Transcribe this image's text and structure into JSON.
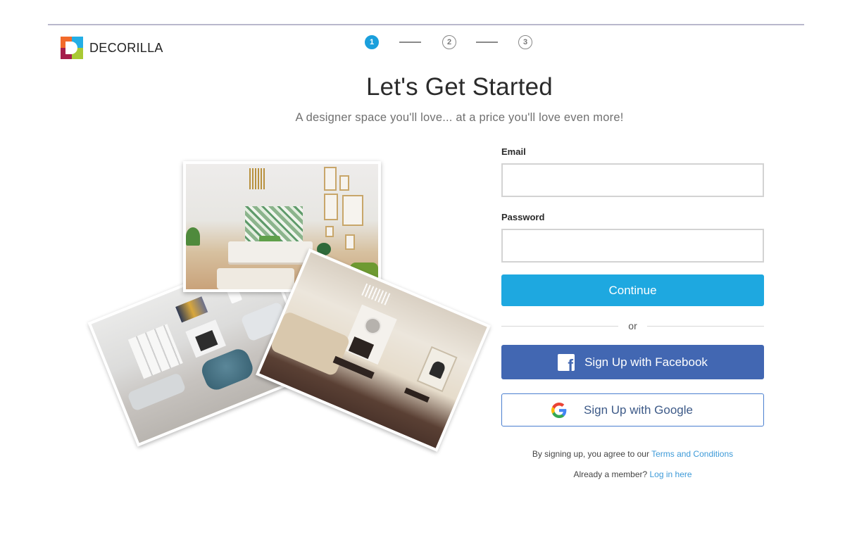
{
  "brand": {
    "name": "DECORILLA",
    "logo_colors": [
      "#f26a2a",
      "#23aee5",
      "#a51d4b",
      "#a9c934"
    ]
  },
  "stepper": {
    "steps": [
      {
        "label": "1",
        "state": "active"
      },
      {
        "label": "2",
        "state": "inactive"
      },
      {
        "label": "3",
        "state": "inactive"
      }
    ],
    "current_step": 1,
    "total_steps": 3
  },
  "header": {
    "title": "Let's Get Started",
    "subtitle": "A designer space you'll love... at a price you'll love even more!"
  },
  "collage": {
    "photos": [
      {
        "subject": "bedroom with tropical wallpaper"
      },
      {
        "subject": "living room with blue tufted ottoman"
      },
      {
        "subject": "lounge with fireplace and horse artwork"
      }
    ]
  },
  "form": {
    "email": {
      "label": "Email",
      "value": "",
      "placeholder": ""
    },
    "password": {
      "label": "Password",
      "value": "",
      "placeholder": ""
    },
    "continue_label": "Continue",
    "divider_text": "or",
    "facebook_label": "Sign Up with Facebook",
    "facebook_icon_glyph": "f",
    "google_label": "Sign Up with Google"
  },
  "footer": {
    "legal_prefix": "By signing up, you agree to our ",
    "legal_link": "Terms and Conditions",
    "member_prefix": "Already a member? ",
    "member_link": "Log in here"
  },
  "colors": {
    "accent": "#1ea8e0",
    "facebook": "#4267b2",
    "google_border": "#4a7fd0",
    "link": "#3d9ad8",
    "step_active": "#1a9fdc"
  }
}
